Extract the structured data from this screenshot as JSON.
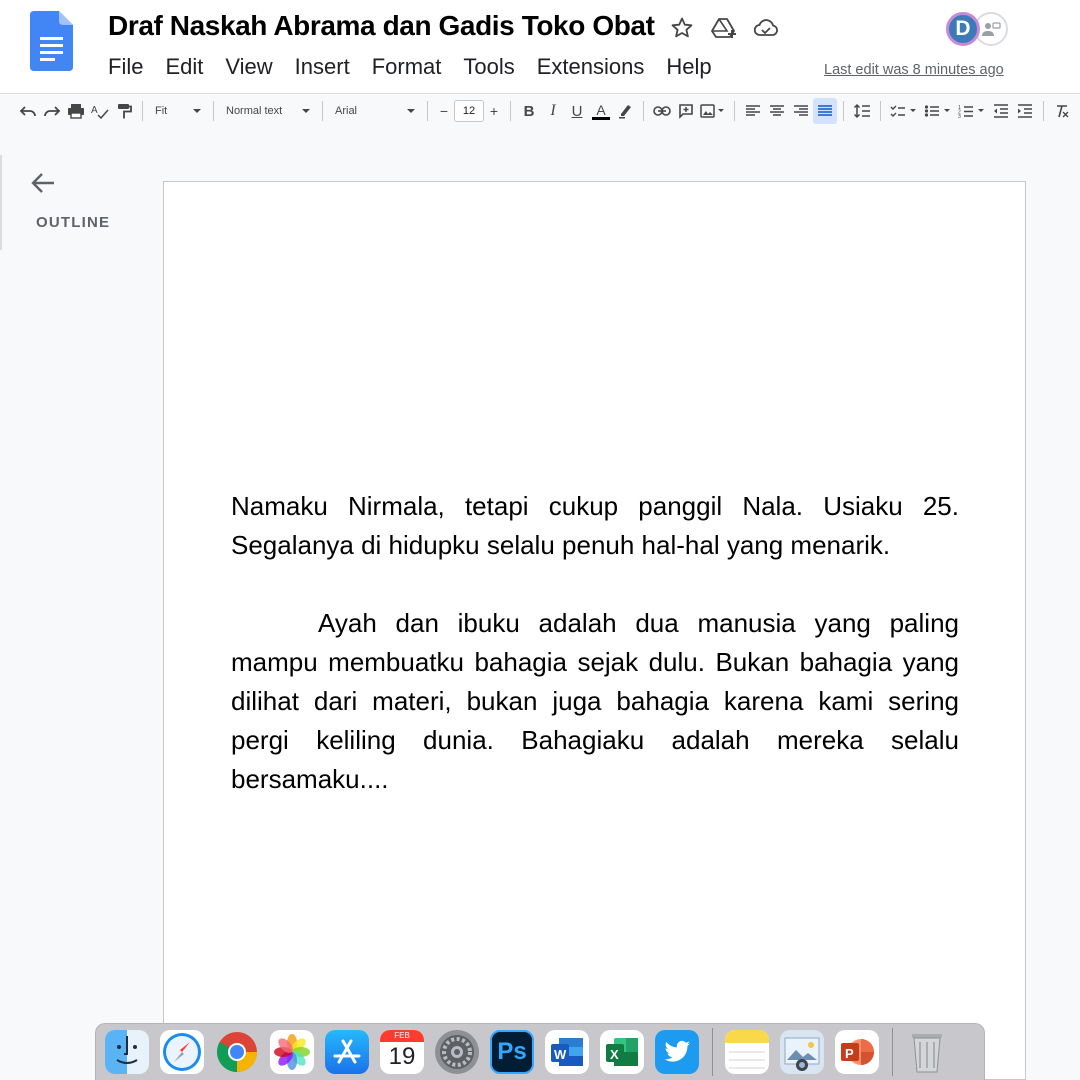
{
  "header": {
    "title": "Draf Naskah Abrama dan Gadis Toko Obat",
    "last_edit": "Last edit was 8 minutes ago",
    "avatar_initial": "D",
    "menu": [
      "File",
      "Edit",
      "View",
      "Insert",
      "Format",
      "Tools",
      "Extensions",
      "Help"
    ]
  },
  "toolbar": {
    "zoom": "Fit",
    "style": "Normal text",
    "font": "Arial",
    "font_size": "12",
    "minus": "−",
    "plus": "+",
    "bold": "B",
    "italic": "I",
    "underline": "U",
    "text_color": "A"
  },
  "outline": {
    "label": "OUTLINE"
  },
  "document": {
    "paragraphs": [
      "Namaku Nirmala, tetapi cukup panggil Nala. Usiaku 25. Segalanya di hidupku selalu penuh hal-hal yang menarik.",
      "Ayah dan ibuku adalah dua manusia yang paling mampu membuatku bahagia sejak dulu. Bukan bahagia yang dilihat dari materi, bukan juga bahagia karena kami sering pergi keliling dunia. Bahagiaku adalah mereka selalu bersamaku...."
    ]
  },
  "dock": {
    "calendar_month": "FEB",
    "calendar_day": "19",
    "ps_label": "Ps",
    "apps": [
      "finder-icon",
      "safari-icon",
      "chrome-icon",
      "photos-icon",
      "app-store-icon",
      "calendar-icon",
      "system-preferences-icon",
      "photoshop-icon",
      "word-icon",
      "excel-icon",
      "twitter-icon",
      "notes-icon",
      "preview-icon",
      "powerpoint-icon",
      "trash-icon"
    ]
  },
  "colors": {
    "docs_blue": "#4285f4",
    "accent_active": "#d3e3fd",
    "avatar_bg": "#3d7ab8"
  }
}
